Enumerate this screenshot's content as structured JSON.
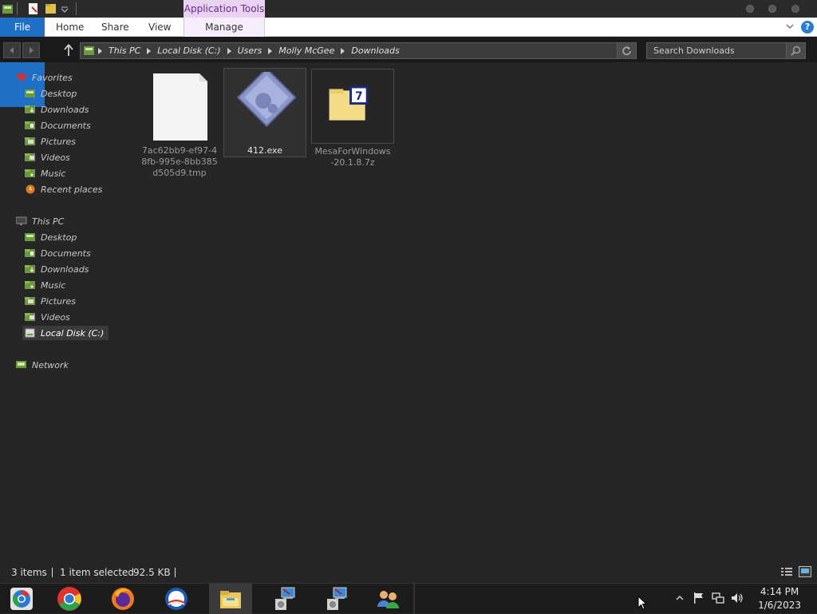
{
  "title_bar": {
    "contextual_tab": "Application Tools"
  },
  "ribbon": {
    "tabs": [
      {
        "label": "File"
      },
      {
        "label": "Home"
      },
      {
        "label": "Share"
      },
      {
        "label": "View"
      },
      {
        "label": "Manage"
      }
    ]
  },
  "address_bar": {
    "crumbs": [
      "This PC",
      "Local Disk (C:)",
      "Users",
      "Molly McGee",
      "Downloads"
    ]
  },
  "search": {
    "placeholder": "Search Downloads"
  },
  "nav_pane": {
    "favorites": "Favorites",
    "favorite_items": [
      "Desktop",
      "Downloads",
      "Documents",
      "Pictures",
      "Videos",
      "Music",
      "Recent places"
    ],
    "this_pc": "This PC",
    "this_pc_items": [
      "Desktop",
      "Documents",
      "Downloads",
      "Music",
      "Pictures",
      "Videos",
      "Local Disk (C:)"
    ],
    "network": "Network"
  },
  "files": [
    {
      "name": "7ac62bb9-ef97-48fb-995e-8bb385d505d9.tmp",
      "icon": "blank-file-icon"
    },
    {
      "name": "412.exe",
      "icon": "installer-exe-icon",
      "state": "selected"
    },
    {
      "name": "MesaForWindows-20.1.8.7z",
      "icon": "7zip-archive-icon",
      "state": "hovered"
    }
  ],
  "status_bar": {
    "item_count": "3 items",
    "selection": "1 item selected",
    "size": "92.5 KB"
  },
  "taskbar": {
    "apps": [
      "chrome-remote-icon",
      "chrome-icon",
      "firefox-icon",
      "obama-logo-icon",
      "file-explorer-icon",
      "setup-installer-icon",
      "setup-installer-icon",
      "network-people-icon"
    ],
    "time": "4:14 PM",
    "date": "1/6/2023"
  }
}
